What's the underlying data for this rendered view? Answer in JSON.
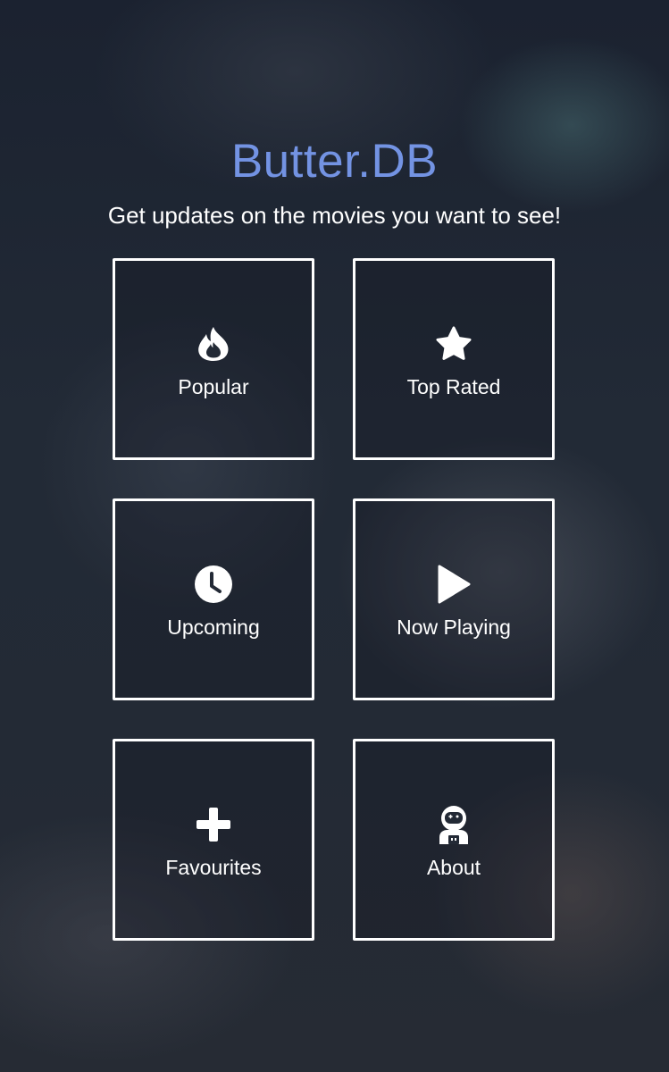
{
  "header": {
    "title": "Butter.DB",
    "tagline": "Get updates on the movies you want to see!",
    "title_color": "#7393e3"
  },
  "menu": [
    {
      "label": "Popular",
      "icon": "fire-icon"
    },
    {
      "label": "Top Rated",
      "icon": "star-icon"
    },
    {
      "label": "Upcoming",
      "icon": "clock-icon"
    },
    {
      "label": "Now Playing",
      "icon": "play-icon"
    },
    {
      "label": "Favourites",
      "icon": "plus-icon"
    },
    {
      "label": "About",
      "icon": "astronaut-icon"
    }
  ]
}
